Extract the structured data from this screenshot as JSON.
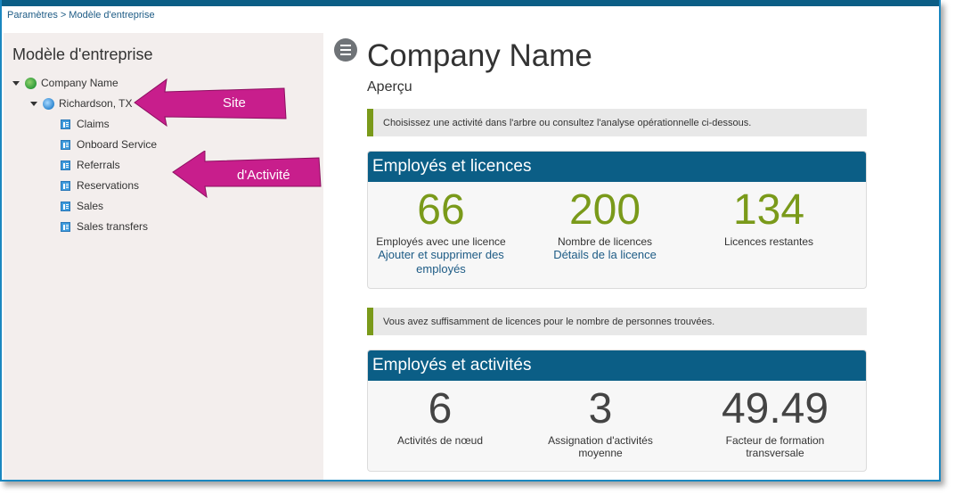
{
  "breadcrumb": {
    "parent": "Paramètres",
    "separator": ">",
    "current": "Modèle d'entreprise"
  },
  "sidebar": {
    "title": "Modèle d'entreprise",
    "company": "Company Name",
    "site": "Richardson, TX",
    "activities": [
      "Claims",
      "Onboard Service",
      "Referrals",
      "Reservations",
      "Sales",
      "Sales transfers"
    ]
  },
  "callouts": {
    "site": "Site",
    "activity": "d'Activité",
    "color": "#c81e8c"
  },
  "main": {
    "title": "Company Name",
    "subtitle": "Aperçu",
    "notice1": "Choisissez une activité dans l'arbre ou consultez l'analyse opérationnelle ci-dessous.",
    "notice2": "Vous avez suffisamment de licences pour le nombre de personnes trouvées.",
    "licenses_card": {
      "title": "Employés et licences",
      "stats": [
        {
          "value": "66",
          "label": "Employés avec une licence",
          "link": "Ajouter et supprimer des employés"
        },
        {
          "value": "200",
          "label": "Nombre de licences",
          "link": "Détails de la licence"
        },
        {
          "value": "134",
          "label": "Licences restantes"
        }
      ]
    },
    "activities_card": {
      "title": "Employés et activités",
      "stats": [
        {
          "value": "6",
          "label": "Activités de nœud"
        },
        {
          "value": "3",
          "label": "Assignation d'activités moyenne"
        },
        {
          "value": "49.49",
          "label": "Facteur de formation transversale"
        }
      ]
    }
  },
  "colors": {
    "header": "#0b5e86",
    "accent_green": "#7a9a1a",
    "link": "#1d5b85"
  }
}
